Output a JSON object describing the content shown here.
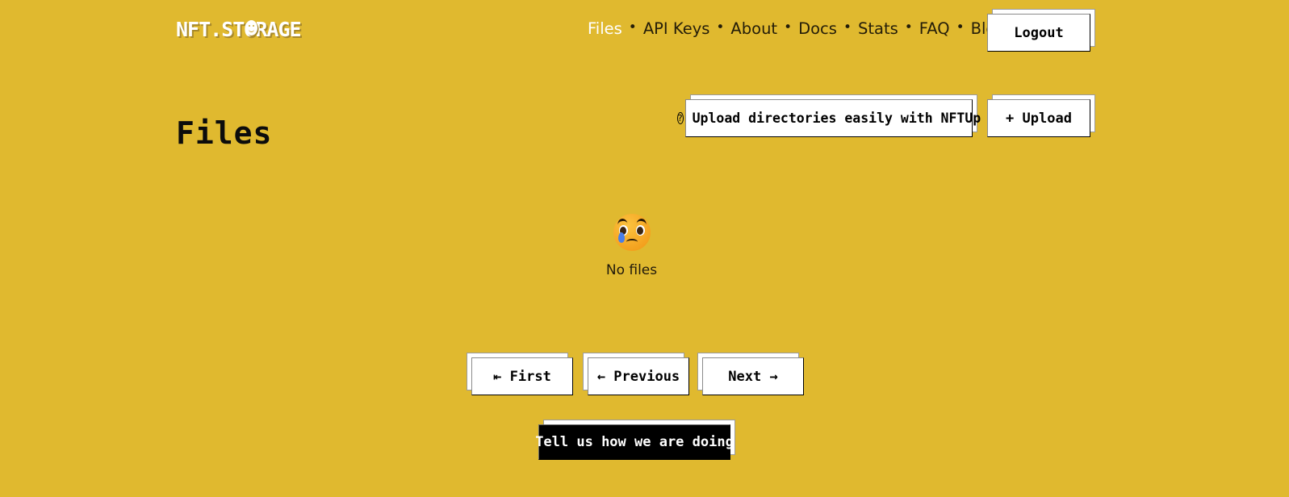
{
  "theme": {
    "background": "#e0b92f",
    "button_bg": "#ffffff",
    "button_text": "#000000",
    "feedback_bg": "#000000",
    "feedback_text": "#ffffff",
    "nav_text": "#241d09",
    "nav_active_text": "#ffffff"
  },
  "header": {
    "logo_text": "NFT.STORAGE",
    "nav": [
      {
        "label": "Files",
        "active": true
      },
      {
        "label": "API Keys",
        "active": false
      },
      {
        "label": "About",
        "active": false
      },
      {
        "label": "Docs",
        "active": false
      },
      {
        "label": "Stats",
        "active": false
      },
      {
        "label": "FAQ",
        "active": false
      },
      {
        "label": "Blog",
        "active": false
      }
    ],
    "nav_separator": "•",
    "logout_label": "Logout"
  },
  "main": {
    "page_title": "Files",
    "nftup_icon": "question-circle-icon",
    "nftup_label": "Upload directories easily with NFTUp",
    "upload_label": "+ Upload",
    "empty_state": {
      "emoji": "sad-but-relieved-face",
      "message": "No files"
    }
  },
  "pagination": {
    "first_label": "⇤ First",
    "previous_label": "← Previous",
    "next_label": "Next →"
  },
  "feedback": {
    "label": "Tell us how we are doing"
  }
}
